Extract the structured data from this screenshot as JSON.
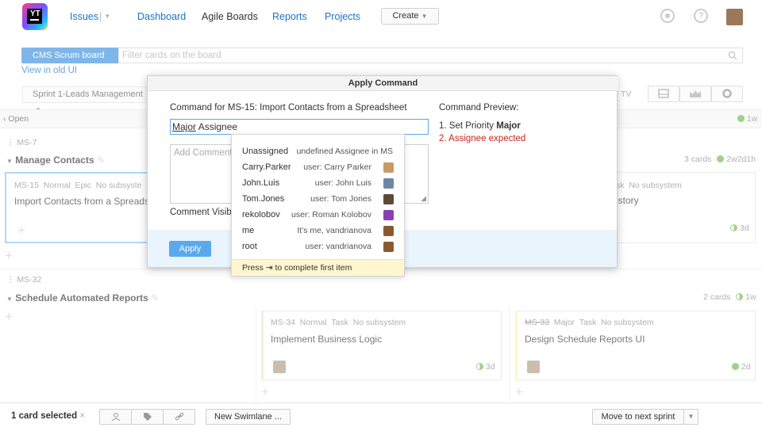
{
  "nav": {
    "logo_text": "YT",
    "issues": "Issues",
    "dashboard": "Dashboard",
    "agile_boards": "Agile Boards",
    "reports": "Reports",
    "projects": "Projects",
    "create": "Create",
    "help_icon": "?"
  },
  "filter": {
    "board": "CMS Scrum board",
    "placeholder": "Filter cards on the board",
    "view_old": "View in old UI"
  },
  "toolbar": {
    "sprint": "Sprint 1-Leads Management",
    "tv": "TV"
  },
  "columns": {
    "open": "Open",
    "open_time": "1w"
  },
  "swimlanes": [
    {
      "id": "MS-7",
      "title": "Manage Contacts",
      "count": "3 cards",
      "time": "2w2d1h",
      "cards": [
        {
          "id": "MS-15",
          "priority": "Normal",
          "type": "Epic",
          "subsystem": "No subsyste",
          "summary": "Import Contacts from a Spreadshe"
        },
        {
          "id": "",
          "priority": "",
          "type": "sk",
          "subsystem": "No subsystem",
          "summary": "istory",
          "time": "3d"
        }
      ]
    },
    {
      "id": "MS-32",
      "title": "Schedule Automated Reports",
      "count": "2 cards",
      "time": "1w",
      "cards": [
        {
          "id": "MS-34",
          "priority": "Normal",
          "type": "Task",
          "subsystem": "No subsystem",
          "summary": "Implement Business Logic",
          "time": "3d"
        },
        {
          "id": "MS-33",
          "priority": "Major",
          "type": "Task",
          "subsystem": "No subsystem",
          "summary": "Design Schedule Reports UI",
          "time": "2d"
        }
      ]
    }
  ],
  "bottom": {
    "selected": "1 card selected",
    "close": "×",
    "new_swimlane": "New Swimlane ...",
    "move_next": "Move to next sprint"
  },
  "dialog": {
    "title": "Apply Command",
    "command_for_prefix": "Command for",
    "issue_id": "MS-15:",
    "issue_summary": "Import Contacts from a Spreadsheet",
    "command_word1": "Major",
    "command_word2": "Assignee",
    "comment_placeholder": "Add Comment",
    "comment_visibility": "Comment Visibil",
    "preview_label": "Command Preview:",
    "preview_1_prefix": "1. Set Priority",
    "preview_1_value": "Major",
    "preview_2": "2. Assignee expected",
    "apply": "Apply"
  },
  "suggestions": [
    {
      "name": "Unassigned",
      "desc": "undefined Assignee in MS",
      "avatar": ""
    },
    {
      "name": "Carry.Parker",
      "desc": "user: Carry Parker",
      "avatar": "#c79a6a"
    },
    {
      "name": "John.Luis",
      "desc": "user: John Luis",
      "avatar": "#6d86a8"
    },
    {
      "name": "Tom.Jones",
      "desc": "user: Tom Jones",
      "avatar": "#5c4a3b"
    },
    {
      "name": "rekolobov",
      "desc": "user: Roman Kolobov",
      "avatar": "#8a3fb6"
    },
    {
      "name": "me",
      "desc": "It's me, vandrianova",
      "avatar": "#8a5a2e"
    },
    {
      "name": "root",
      "desc": "user: vandrianova",
      "avatar": "#8a5a2e"
    }
  ],
  "suggest_footer": "Press ⇥ to complete first item"
}
